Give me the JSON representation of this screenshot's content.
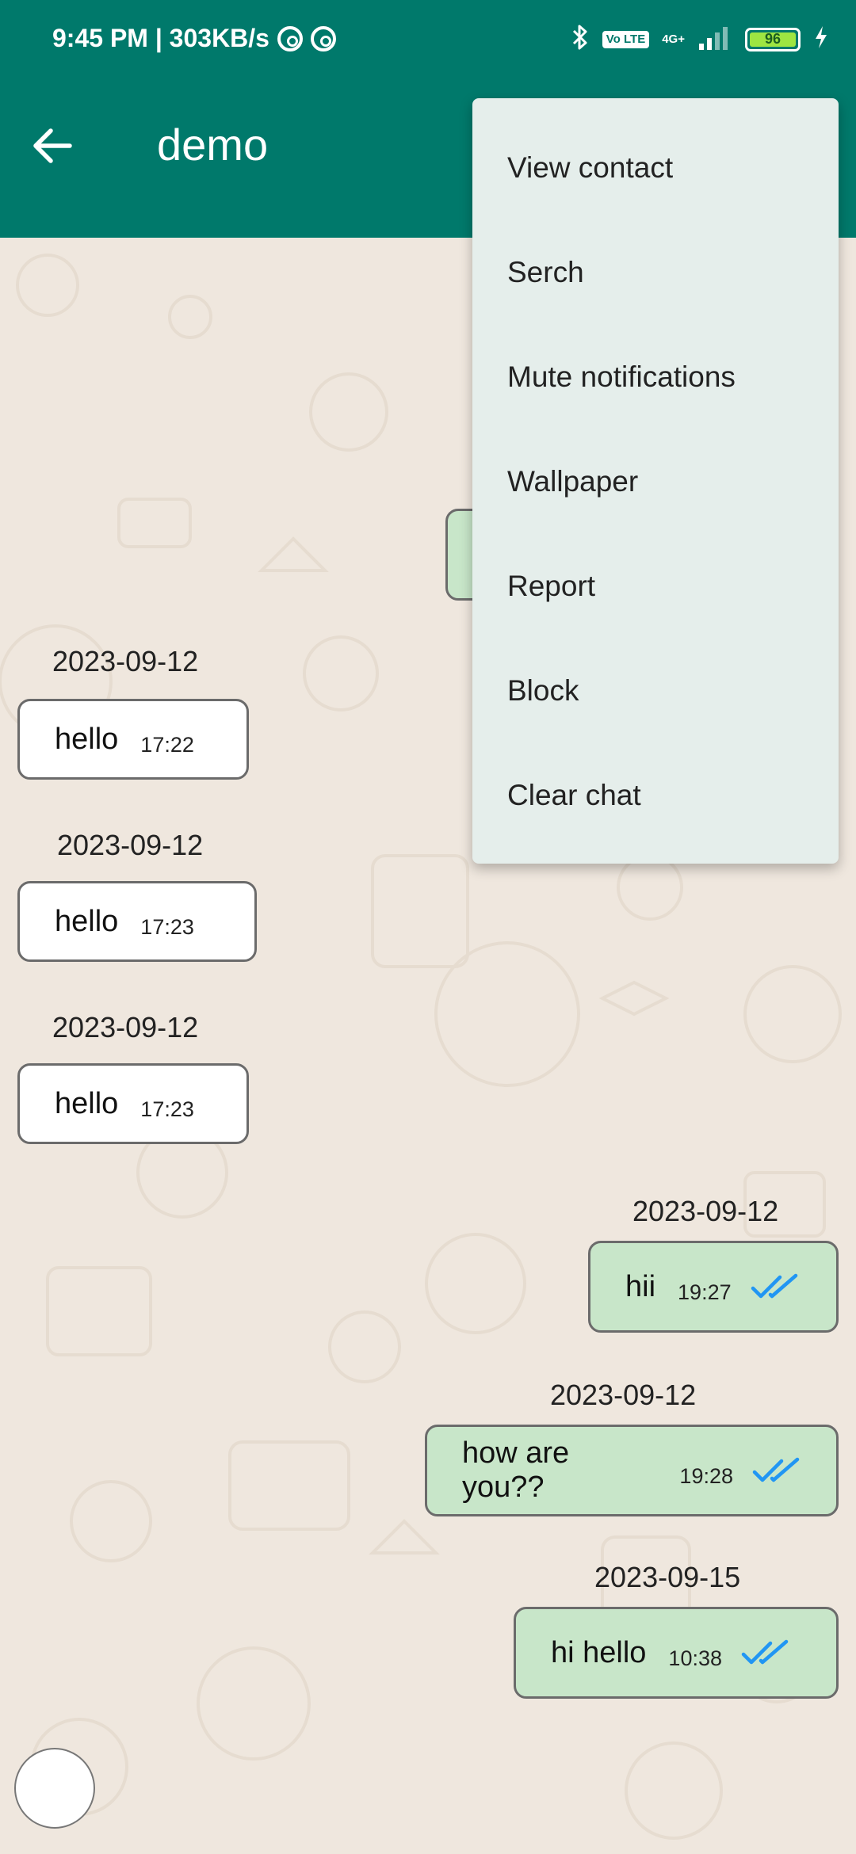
{
  "status_bar": {
    "time_speed": "9:45 PM | 303KB/s",
    "volte": "Vo LTE",
    "network": "4G+",
    "battery": "96"
  },
  "app_bar": {
    "title": "demo"
  },
  "menu": {
    "items": [
      "View contact",
      "Serch",
      "Mute notifications",
      "Wallpaper",
      "Report",
      "Block",
      "Clear chat"
    ]
  },
  "messages": [
    {
      "date": "2023-09-12",
      "text": "hello",
      "time": "17:22",
      "direction": "incoming"
    },
    {
      "date": "2023-09-12",
      "text": "hello",
      "time": "17:23",
      "direction": "incoming"
    },
    {
      "date": "2023-09-12",
      "text": "hello",
      "time": "17:23",
      "direction": "incoming"
    },
    {
      "date": "2023-09-12",
      "text": "hii",
      "time": "19:27",
      "direction": "outgoing"
    },
    {
      "date": "2023-09-12",
      "text": "how are you??",
      "time": "19:28",
      "direction": "outgoing"
    },
    {
      "date": "2023-09-15",
      "text": "hi hello",
      "time": "10:38",
      "direction": "outgoing"
    }
  ],
  "colors": {
    "primary": "#00796b",
    "chat_background": "#efe7de",
    "outgoing_bubble": "#c8e6c9",
    "incoming_bubble": "#ffffff",
    "menu_background": "#e5eeeb",
    "tick_blue": "#2196f3"
  }
}
